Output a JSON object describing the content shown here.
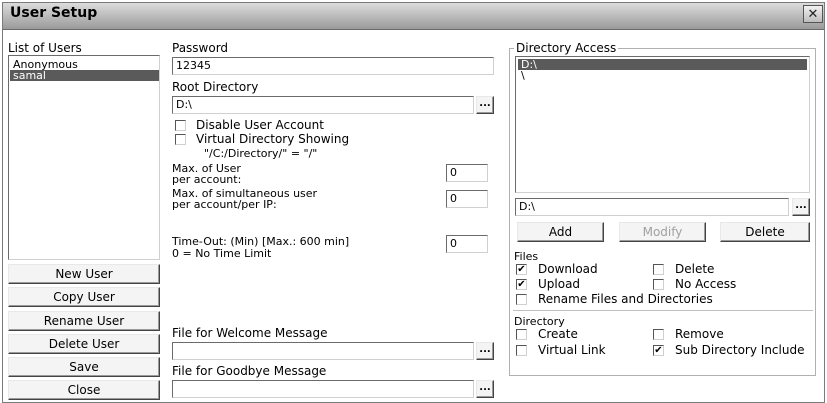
{
  "window": {
    "title": "User Setup",
    "close_glyph": "✕"
  },
  "users": {
    "label": "List of Users",
    "items": [
      {
        "name": "Anonymous",
        "selected": false
      },
      {
        "name": "samal",
        "selected": true
      }
    ]
  },
  "buttons": {
    "new_user": "New User",
    "copy_user": "Copy User",
    "rename_user": "Rename User",
    "delete_user": "Delete User",
    "save": "Save",
    "close": "Close"
  },
  "password": {
    "label": "Password",
    "value": "12345"
  },
  "root_directory": {
    "label": "Root Directory",
    "value": "D:\\"
  },
  "options": {
    "disable_account": {
      "label": "Disable User Account",
      "checked": false
    },
    "virtual_directory": {
      "label": "Virtual Directory Showing",
      "hint": "\"/C:/Directory/\" = \"/\"",
      "checked": false
    }
  },
  "limits": {
    "max_user_label_1": "Max. of User",
    "max_user_label_2": "per account:",
    "max_user_value": "0",
    "max_simul_label_1": "Max. of simultaneous user",
    "max_simul_label_2": "per account/per IP:",
    "max_simul_value": "0",
    "timeout_label_1": "Time-Out: (Min) [Max.: 600 min]",
    "timeout_label_2": "0 = No Time Limit",
    "timeout_value": "0"
  },
  "welcome_file": {
    "label": "File for Welcome Message",
    "value": ""
  },
  "goodbye_file": {
    "label": "File for Goodbye Message",
    "value": ""
  },
  "browse_glyph": "...",
  "directory_access": {
    "label": "Directory Access",
    "items": [
      {
        "path": "D:\\",
        "selected": true
      },
      {
        "path": "\\",
        "selected": false
      }
    ],
    "path_value": "D:\\",
    "add": "Add",
    "modify": "Modify",
    "delete": "Delete"
  },
  "files": {
    "label": "Files",
    "download": {
      "label": "Download",
      "checked": true
    },
    "delete": {
      "label": "Delete",
      "checked": false
    },
    "upload": {
      "label": "Upload",
      "checked": true
    },
    "no_access": {
      "label": "No Access",
      "checked": false
    },
    "rename": {
      "label": "Rename Files and Directories",
      "checked": false
    }
  },
  "directory": {
    "label": "Directory",
    "create": {
      "label": "Create",
      "checked": false
    },
    "remove": {
      "label": "Remove",
      "checked": false
    },
    "virtual_link": {
      "label": "Virtual Link",
      "checked": false
    },
    "sub_include": {
      "label": "Sub Directory Include",
      "checked": true
    }
  },
  "check_glyph": "✔"
}
